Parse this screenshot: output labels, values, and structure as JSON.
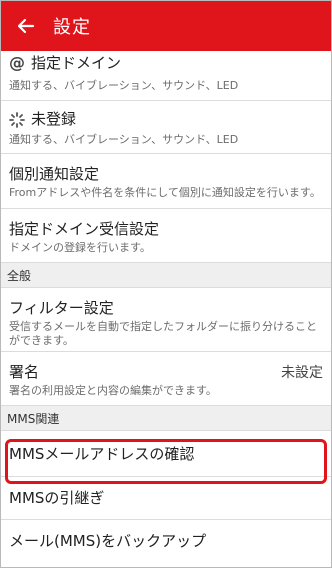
{
  "header": {
    "title": "設定"
  },
  "items": [
    {
      "title": "指定ドメイン",
      "desc": "通知する、バイブレーション、サウンド、LED"
    },
    {
      "title": "未登録",
      "desc": "通知する、バイブレーション、サウンド、LED"
    },
    {
      "title": "個別通知設定",
      "desc": "Fromアドレスや件名を条件にして個別に通知設定を行います。"
    },
    {
      "title": "指定ドメイン受信設定",
      "desc": "ドメインの登録を行います。"
    }
  ],
  "section_general": "全般",
  "filter": {
    "title": "フィルター設定",
    "desc_line1": "受信するメールを自動で指定したフォルダーに振り分けること",
    "desc_line2": "ができます。"
  },
  "signature": {
    "title": "署名",
    "desc": "署名の利用設定と内容の編集ができます。",
    "value": "未設定"
  },
  "section_mms": "MMS関連",
  "mms_items": [
    {
      "title": "MMSメールアドレスの確認"
    },
    {
      "title": "MMSの引継ぎ"
    },
    {
      "title": "メール(MMS)をバックアップ"
    }
  ],
  "colors": {
    "accent": "#e0151b"
  }
}
